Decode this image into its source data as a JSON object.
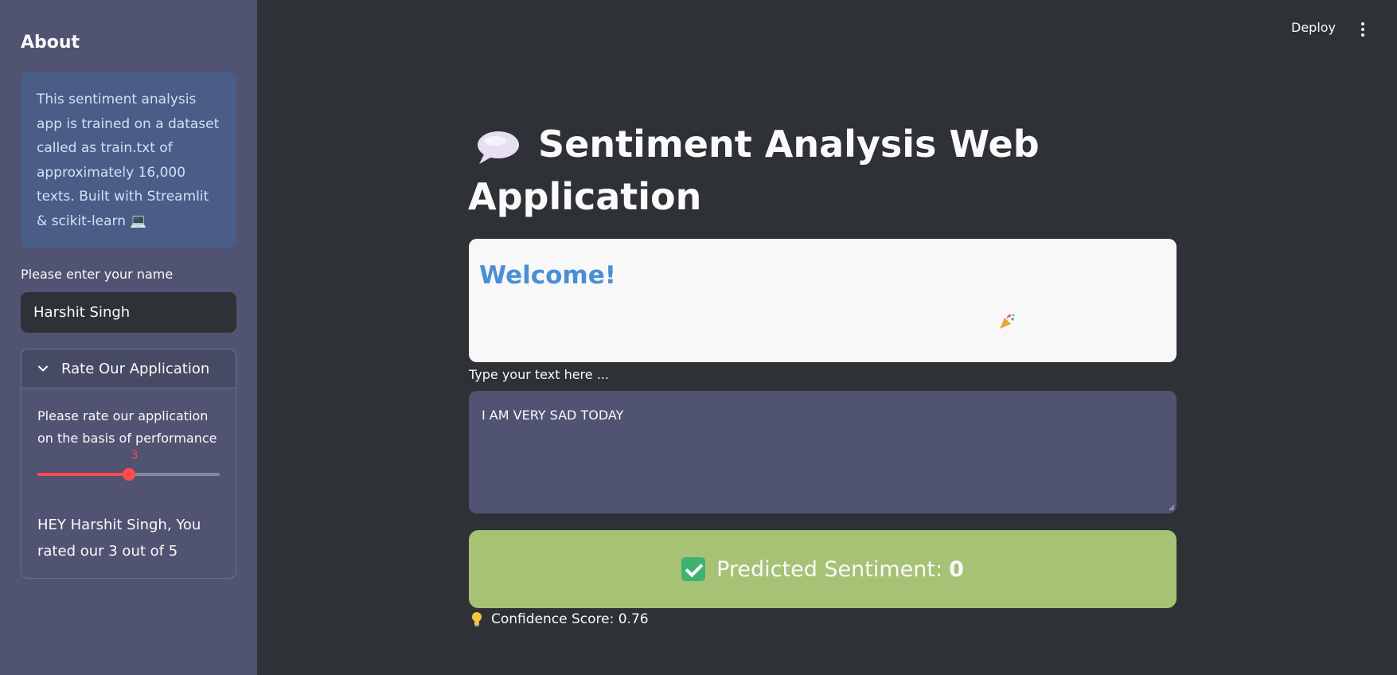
{
  "sidebar": {
    "title": "About",
    "info": "This sentiment analysis app is trained on a dataset called as train.txt of approximately 16,000 texts. Built with Streamlit & scikit-learn 💻",
    "name_label": "Please enter your name",
    "name_value": "Harshit Singh",
    "expander": {
      "title": "Rate Our Application",
      "rate_label": "Please rate our application on the basis of performance",
      "slider_value": "3",
      "slider_fraction": 0.5,
      "message": "HEY Harshit Singh, You rated our 3 out of 5"
    }
  },
  "header": {
    "deploy_label": "Deploy"
  },
  "main": {
    "title": "Sentiment Analysis Web Application",
    "welcome": "Welcome!",
    "text_label": "Type your text here ...",
    "text_value": "I AM VERY SAD TODAY",
    "result_label": "Predicted Sentiment:",
    "result_value": "0",
    "confidence": "Confidence Score: 0.76"
  },
  "colors": {
    "accent": "#ff4b4b",
    "sidebar_bg": "#515373",
    "main_bg": "#2e3135",
    "info_bg": "#4a5d86",
    "result_bg": "#a6c275",
    "welcome_text": "#4a8fd6"
  },
  "icons": {
    "title": "speech-bubble-icon",
    "laptop": "laptop-icon",
    "party": "party-popper-icon",
    "result": "check-mark-icon",
    "confidence": "light-bulb-icon",
    "expander": "chevron-down-icon",
    "menu": "kebab-menu-icon"
  }
}
